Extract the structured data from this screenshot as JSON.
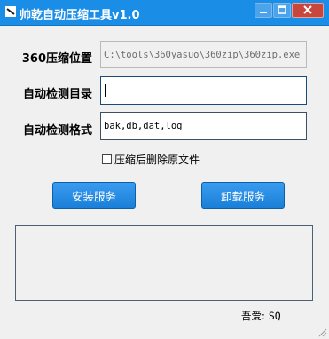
{
  "window": {
    "title": "帅乾自动压缩工具v1.0",
    "icons": {
      "app": "app-logo-icon",
      "minimize": "minimize-icon",
      "maximize": "maximize-icon",
      "close": "close-icon"
    }
  },
  "form": {
    "zip_location_label": "360压缩位置",
    "zip_location_value": "C:\\tools\\360yasuo\\360zip\\360zip.exe",
    "watch_dir_label": "自动检测目录",
    "watch_dir_value": "",
    "watch_format_label": "自动检测格式",
    "watch_format_value": "bak,db,dat,log",
    "delete_after_label": "压缩后删除原文件",
    "delete_after_checked": false
  },
  "actions": {
    "install_label": "安装服务",
    "uninstall_label": "卸载服务"
  },
  "log": {
    "text": ""
  },
  "footer": {
    "author_label": "吾爱:",
    "author_value": "SQ"
  },
  "colors": {
    "titlebar": "#1a8de6",
    "button": "#1a7fd8",
    "close": "#c8463c"
  }
}
